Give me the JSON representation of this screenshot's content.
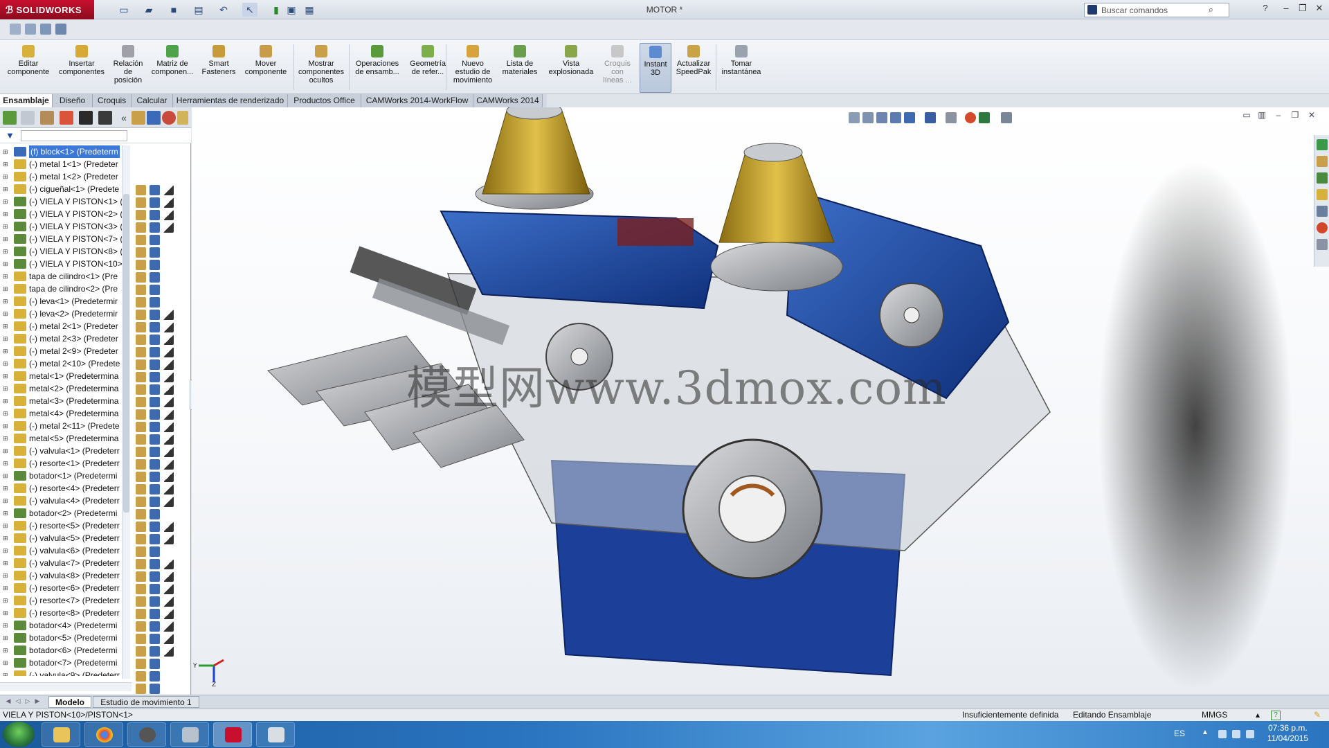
{
  "app": {
    "logo_text": "SOLIDWORKS",
    "doc_title": "MOTOR *",
    "search_placeholder": "Buscar comandos"
  },
  "ribbon": [
    {
      "label": "Editar\ncomponente"
    },
    {
      "label": "Insertar\ncomponentes"
    },
    {
      "label": "Relación\nde\nposición"
    },
    {
      "label": "Matriz de\ncomponen..."
    },
    {
      "label": "Smart\nFasteners"
    },
    {
      "label": "Mover\ncomponente"
    },
    {
      "label": "Mostrar\ncomponentes\nocultos"
    },
    {
      "label": "Operaciones\nde ensamb..."
    },
    {
      "label": "Geometría\nde refer..."
    },
    {
      "label": "Nuevo\nestudio de\nmovimiento"
    },
    {
      "label": "Lista de\nmateriales"
    },
    {
      "label": "Vista\nexplosionada"
    },
    {
      "label": "Croquis\ncon\nlíneas ..."
    },
    {
      "label": "Instant\n3D"
    },
    {
      "label": "Actualizar\nSpeedPak"
    },
    {
      "label": "Tomar\ninstantánea"
    }
  ],
  "cm_tabs": [
    "Ensamblaje",
    "Diseño",
    "Croquis",
    "Calcular",
    "Herramientas de renderizado",
    "Productos Office",
    "CAMWorks 2014-WorkFlow",
    "CAMWorks 2014"
  ],
  "tree": [
    "(f) block<1> (Predeterm",
    "(-) metal 1<1> (Predeter",
    "(-) metal 1<2> (Predeter",
    "(-) cigueñal<1> (Predete",
    "(-) VIELA Y PISTON<1> (",
    "(-) VIELA Y PISTON<2> (",
    "(-) VIELA Y PISTON<3> (",
    "(-) VIELA Y PISTON<7> (",
    "(-) VIELA Y PISTON<8> (",
    "(-) VIELA Y PISTON<10>",
    "tapa de cilindro<1> (Pre",
    "tapa de cilindro<2> (Pre",
    "(-) leva<1> (Predetermir",
    "(-) leva<2> (Predetermir",
    "(-) metal 2<1> (Predeter",
    "(-) metal 2<3> (Predeter",
    "(-) metal 2<9> (Predeter",
    "(-) metal 2<10> (Predete",
    "metal<1> (Predetermina",
    "metal<2> (Predetermina",
    "metal<3> (Predetermina",
    "metal<4> (Predetermina",
    "(-) metal 2<11> (Predete",
    "metal<5> (Predetermina",
    "(-) valvula<1> (Predeterr",
    "(-) resorte<1> (Predeterr",
    "botador<1> (Predetermi",
    "(-) resorte<4> (Predeterr",
    "(-) valvula<4> (Predeterr",
    "botador<2> (Predetermi",
    "(-) resorte<5> (Predeterr",
    "(-) valvula<5> (Predeterr",
    "(-) valvula<6> (Predeterr",
    "(-) valvula<7> (Predeterr",
    "(-) valvula<8> (Predeterr",
    "(-) resorte<6> (Predeterr",
    "(-) resorte<7> (Predeterr",
    "(-) resorte<8> (Predeterr",
    "botador<4> (Predetermi",
    "botador<5> (Predetermi",
    "botador<6> (Predetermi",
    "botador<7> (Predetermi",
    "(-) valvula<9> (Predeterr"
  ],
  "viewport": {
    "watermark": "模型网www.3dmox.com"
  },
  "bottom_tabs": [
    "Modelo",
    "Estudio de movimiento 1"
  ],
  "status": {
    "path": "VIELA Y PISTON<10>/PISTON<1>",
    "definition": "Insuficientemente definida",
    "mode": "Editando Ensamblaje",
    "units": "MMGS"
  },
  "taskbar": {
    "lang": "ES",
    "time": "07:36 p.m.",
    "date": "11/04/2015"
  },
  "colors": {
    "engine_blue": "#1f4fa8",
    "filter_gold": "#c9a933",
    "selection": "#3b78d8",
    "sw_red": "#c8102e"
  }
}
